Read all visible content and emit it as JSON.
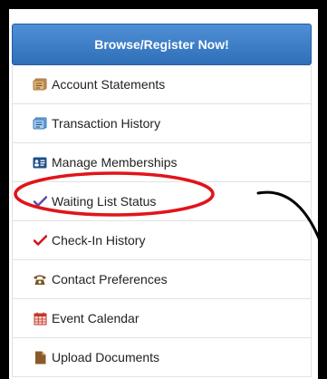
{
  "browse_button": {
    "label": "Browse/Register Now!"
  },
  "menu": {
    "items": [
      {
        "label": "Account Statements",
        "icon": "statement-icon"
      },
      {
        "label": "Transaction History",
        "icon": "history-icon"
      },
      {
        "label": "Manage Memberships",
        "icon": "membership-card-icon"
      },
      {
        "label": "Waiting List Status",
        "icon": "checkmark-icon"
      },
      {
        "label": "Check-In History",
        "icon": "checkmark-icon"
      },
      {
        "label": "Contact Preferences",
        "icon": "phone-icon"
      },
      {
        "label": "Event Calendar",
        "icon": "calendar-icon"
      },
      {
        "label": "Upload Documents",
        "icon": "document-icon"
      }
    ]
  },
  "colors": {
    "button_blue": "#2f6fb8",
    "highlight_red": "#e0141b",
    "waiting_check_purple": "#5b4fa8",
    "checkin_check_red": "#d4161c",
    "statement_brown": "#a0703a",
    "history_blue": "#3a8ad6",
    "membership_navy": "#1e4f8a",
    "phone_brown": "#7a5520",
    "calendar_red": "#c0392b",
    "document_brown": "#8b5a2b"
  }
}
